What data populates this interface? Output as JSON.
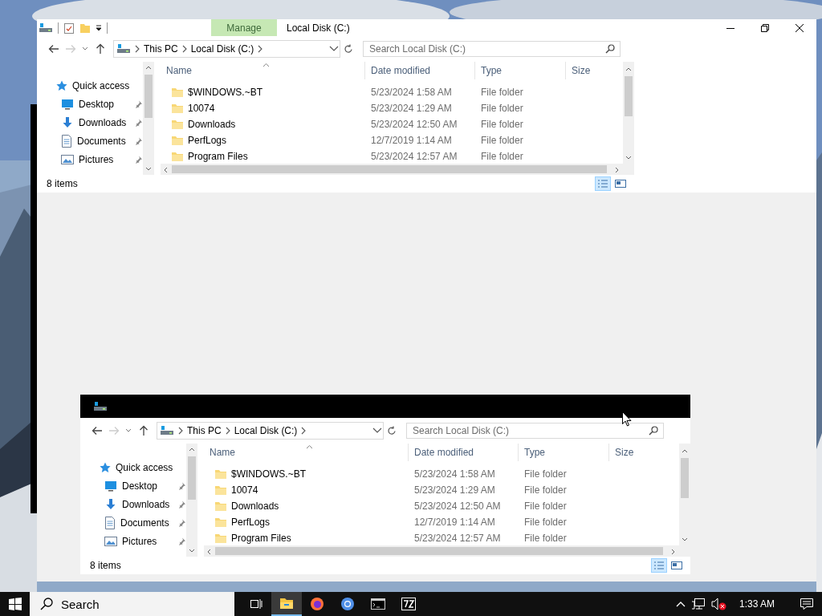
{
  "windows": [
    {
      "kind": "ribbon",
      "contextual_tab": "Manage",
      "title": "Local Disk (C:)",
      "explorer": {
        "breadcrumb": [
          "This PC",
          "Local Disk (C:)"
        ],
        "search": {
          "placeholder": "Search Local Disk (C:)"
        },
        "sidebar": [
          {
            "kind": "quick",
            "label": "Quick access",
            "pinned": false
          },
          {
            "kind": "desktop",
            "label": "Desktop",
            "pinned": true
          },
          {
            "kind": "downloads",
            "label": "Downloads",
            "pinned": true
          },
          {
            "kind": "documents",
            "label": "Documents",
            "pinned": true
          },
          {
            "kind": "pictures",
            "label": "Pictures",
            "pinned": true
          }
        ],
        "columns": [
          "Name",
          "Date modified",
          "Type",
          "Size"
        ],
        "rows": [
          {
            "name": "$WINDOWS.~BT",
            "date": "5/23/2024 1:58 AM",
            "type": "File folder"
          },
          {
            "name": "10074",
            "date": "5/23/2024 1:29 AM",
            "type": "File folder"
          },
          {
            "name": "Downloads",
            "date": "5/23/2024 12:50 AM",
            "type": "File folder"
          },
          {
            "name": "PerfLogs",
            "date": "12/7/2019 1:14 AM",
            "type": "File folder"
          },
          {
            "name": "Program Files",
            "date": "5/23/2024 12:57 AM",
            "type": "File folder"
          }
        ],
        "status": "8 items"
      }
    },
    {
      "kind": "dark",
      "explorer": {
        "breadcrumb": [
          "This PC",
          "Local Disk (C:)"
        ],
        "search": {
          "placeholder": "Search Local Disk (C:)"
        },
        "sidebar": [
          {
            "kind": "quick",
            "label": "Quick access",
            "pinned": false
          },
          {
            "kind": "desktop",
            "label": "Desktop",
            "pinned": true
          },
          {
            "kind": "downloads",
            "label": "Downloads",
            "pinned": true
          },
          {
            "kind": "documents",
            "label": "Documents",
            "pinned": true
          },
          {
            "kind": "pictures",
            "label": "Pictures",
            "pinned": true
          }
        ],
        "columns": [
          "Name",
          "Date modified",
          "Type",
          "Size"
        ],
        "rows": [
          {
            "name": "$WINDOWS.~BT",
            "date": "5/23/2024 1:58 AM",
            "type": "File folder"
          },
          {
            "name": "10074",
            "date": "5/23/2024 1:29 AM",
            "type": "File folder"
          },
          {
            "name": "Downloads",
            "date": "5/23/2024 12:50 AM",
            "type": "File folder"
          },
          {
            "name": "PerfLogs",
            "date": "12/7/2019 1:14 AM",
            "type": "File folder"
          },
          {
            "name": "Program Files",
            "date": "5/23/2024 12:57 AM",
            "type": "File folder"
          }
        ],
        "status": "8 items"
      }
    }
  ],
  "taskbar": {
    "search": "Search",
    "apps": [
      {
        "kind": "explorer",
        "selected": true
      },
      {
        "kind": "firefox",
        "selected": false
      },
      {
        "kind": "chrome",
        "selected": false
      },
      {
        "kind": "terminal",
        "selected": false
      },
      {
        "kind": "archiver",
        "selected": false
      }
    ],
    "clock": "1:33 AM"
  }
}
